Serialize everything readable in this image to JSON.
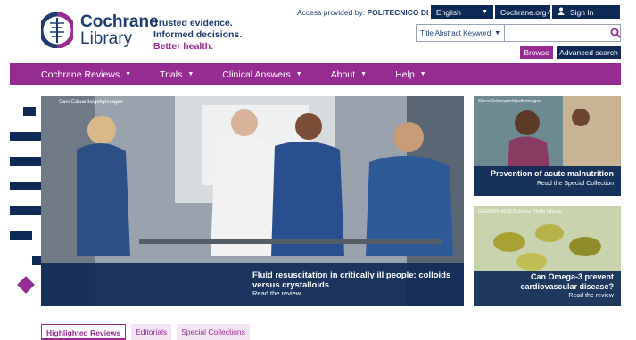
{
  "logo": {
    "line1": "Cochrane",
    "line2": "Library"
  },
  "tagline": {
    "line1": "Trusted evidence.",
    "line2": "Informed decisions.",
    "line3": "Better health."
  },
  "topbar": {
    "access_prefix": "Access provided by:",
    "access_institution": "POLITECNICO DI MILANO",
    "language": "English",
    "org_link": "Cochrane.org",
    "signin": "Sign In"
  },
  "search": {
    "type": "Title Abstract Keyword",
    "placeholder": "",
    "browse": "Browse",
    "advanced": "Advanced search"
  },
  "nav": {
    "items": [
      {
        "label": "Cochrane Reviews"
      },
      {
        "label": "Trials"
      },
      {
        "label": "Clinical Answers"
      },
      {
        "label": "About"
      },
      {
        "label": "Help"
      }
    ]
  },
  "hero": {
    "credit": "Sam Edwards/gettyimages",
    "title": "Fluid resuscitation in critically ill people: colloids versus crystalloids",
    "link": "Read the review"
  },
  "cards": [
    {
      "credit": "SteveDebenport/gettyimages",
      "title": "Prevention of acute malnutrition",
      "link": "Read the Special Collection"
    },
    {
      "credit": "GARO/PHANIE/Science Photo Library",
      "title": "Can Omega-3 prevent cardiovascular disease?",
      "link": "Read the review"
    }
  ],
  "tabs": [
    {
      "label": "Highlighted Reviews",
      "active": true
    },
    {
      "label": "Editorials",
      "active": false
    },
    {
      "label": "Special Collections",
      "active": false
    }
  ],
  "colors": {
    "navy": "#0f2a57",
    "purple": "#962c92",
    "text_blue": "#1d3b6e"
  },
  "icons": [
    "cochrane-logo-icon",
    "external-link-icon",
    "user-icon",
    "search-icon",
    "chevron-down-icon"
  ]
}
